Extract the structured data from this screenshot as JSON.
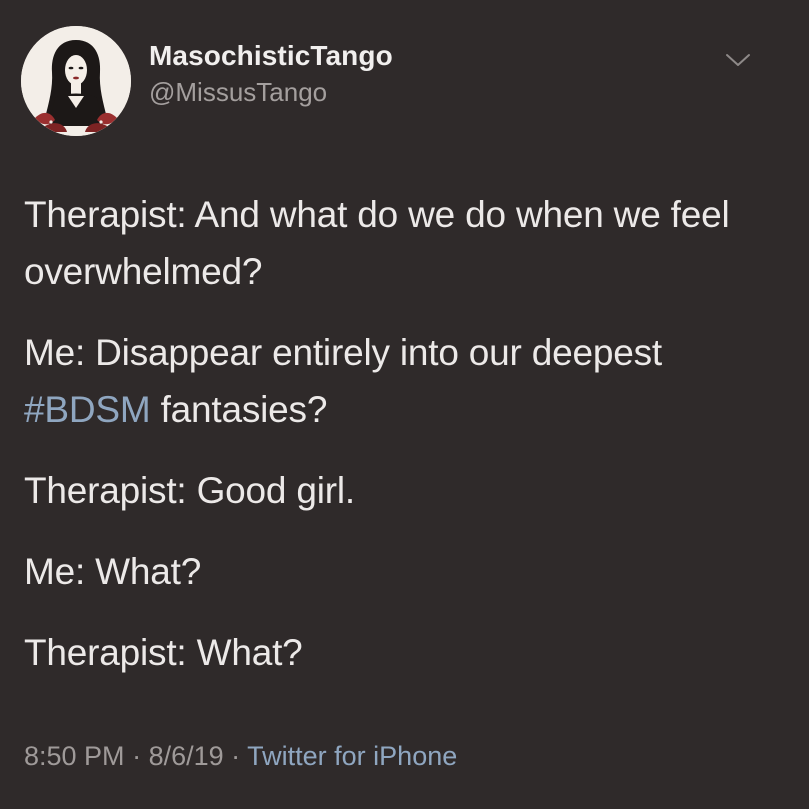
{
  "author": {
    "display_name": "MasochisticTango",
    "handle": "@MissusTango",
    "avatar_icon": "portrait-illustration-avatar"
  },
  "menu": {
    "icon": "chevron-down-icon"
  },
  "tweet": {
    "lines": {
      "p1": "Therapist: And what do we do when we feel overwhelmed?",
      "p2_pre": "Me: Disappear entirely into our deepest ",
      "p2_hashtag": "#BDSM",
      "p2_post": " fantasies?",
      "p3": "Therapist: Good girl.",
      "p4": "Me: What?",
      "p5": "Therapist: What?"
    }
  },
  "meta": {
    "time": "8:50 PM",
    "sep1": " · ",
    "date": "8/6/19",
    "sep2": " · ",
    "source": "Twitter for iPhone"
  },
  "colors": {
    "background": "#2f2a2a",
    "text": "#ece9e8",
    "muted": "#a49f9e",
    "link": "#8fa6c0"
  }
}
